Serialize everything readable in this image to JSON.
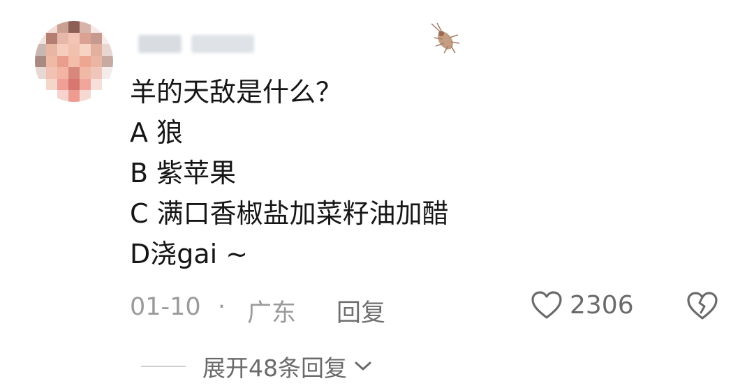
{
  "comment": {
    "lines": [
      "羊的天敌是什么？",
      "A 狼",
      "B 紫苹果",
      "C 满口香椒盐加菜籽油加醋",
      "D浇gai ~"
    ]
  },
  "meta": {
    "date": "01-10",
    "separator": "·",
    "location": "广东",
    "reply_label": "回复",
    "like_count": "2306"
  },
  "expand": {
    "label": "展开48条回复"
  },
  "icons": {
    "like": "heart-outline-icon",
    "dislike": "broken-heart-icon",
    "expand": "chevron-down-icon",
    "decoration": "cockroach-icon"
  },
  "colors": {
    "text": "#161616",
    "meta": "#9a9a9a",
    "action": "#6a6a6a"
  }
}
